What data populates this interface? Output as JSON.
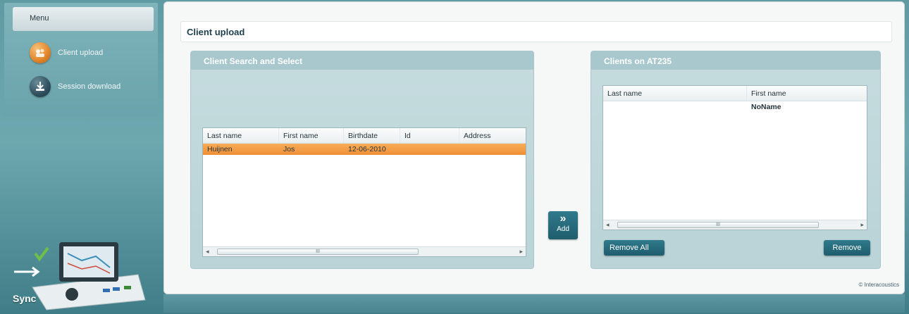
{
  "sidebar": {
    "menu_label": "Menu",
    "items": [
      {
        "label": "Client upload",
        "icon": "upload-icon"
      },
      {
        "label": "Session download",
        "icon": "download-icon"
      }
    ],
    "device_label": "Sync"
  },
  "main": {
    "title": "Client upload",
    "search_panel": {
      "title": "Client Search and Select",
      "columns": [
        "Last name",
        "First name",
        "Birthdate",
        "Id",
        "Address"
      ],
      "rows": [
        {
          "last_name": "Huijnen",
          "first_name": "Jos",
          "birthdate": "12-06-2010",
          "id": "",
          "address": ""
        }
      ]
    },
    "add_button": {
      "label": "Add",
      "icon": "double-chevron-right-icon"
    },
    "device_panel": {
      "title": "Clients on AT235",
      "columns": [
        "Last name",
        "First name"
      ],
      "rows": [
        {
          "last_name": "",
          "first_name": "NoName"
        }
      ],
      "remove_all_label": "Remove All",
      "remove_label": "Remove"
    },
    "copyright": "© Interacoustics"
  },
  "colors": {
    "accent_teal": "#1f5d6d",
    "selection_orange": "#f09036",
    "background_teal": "#5f9aa3"
  }
}
